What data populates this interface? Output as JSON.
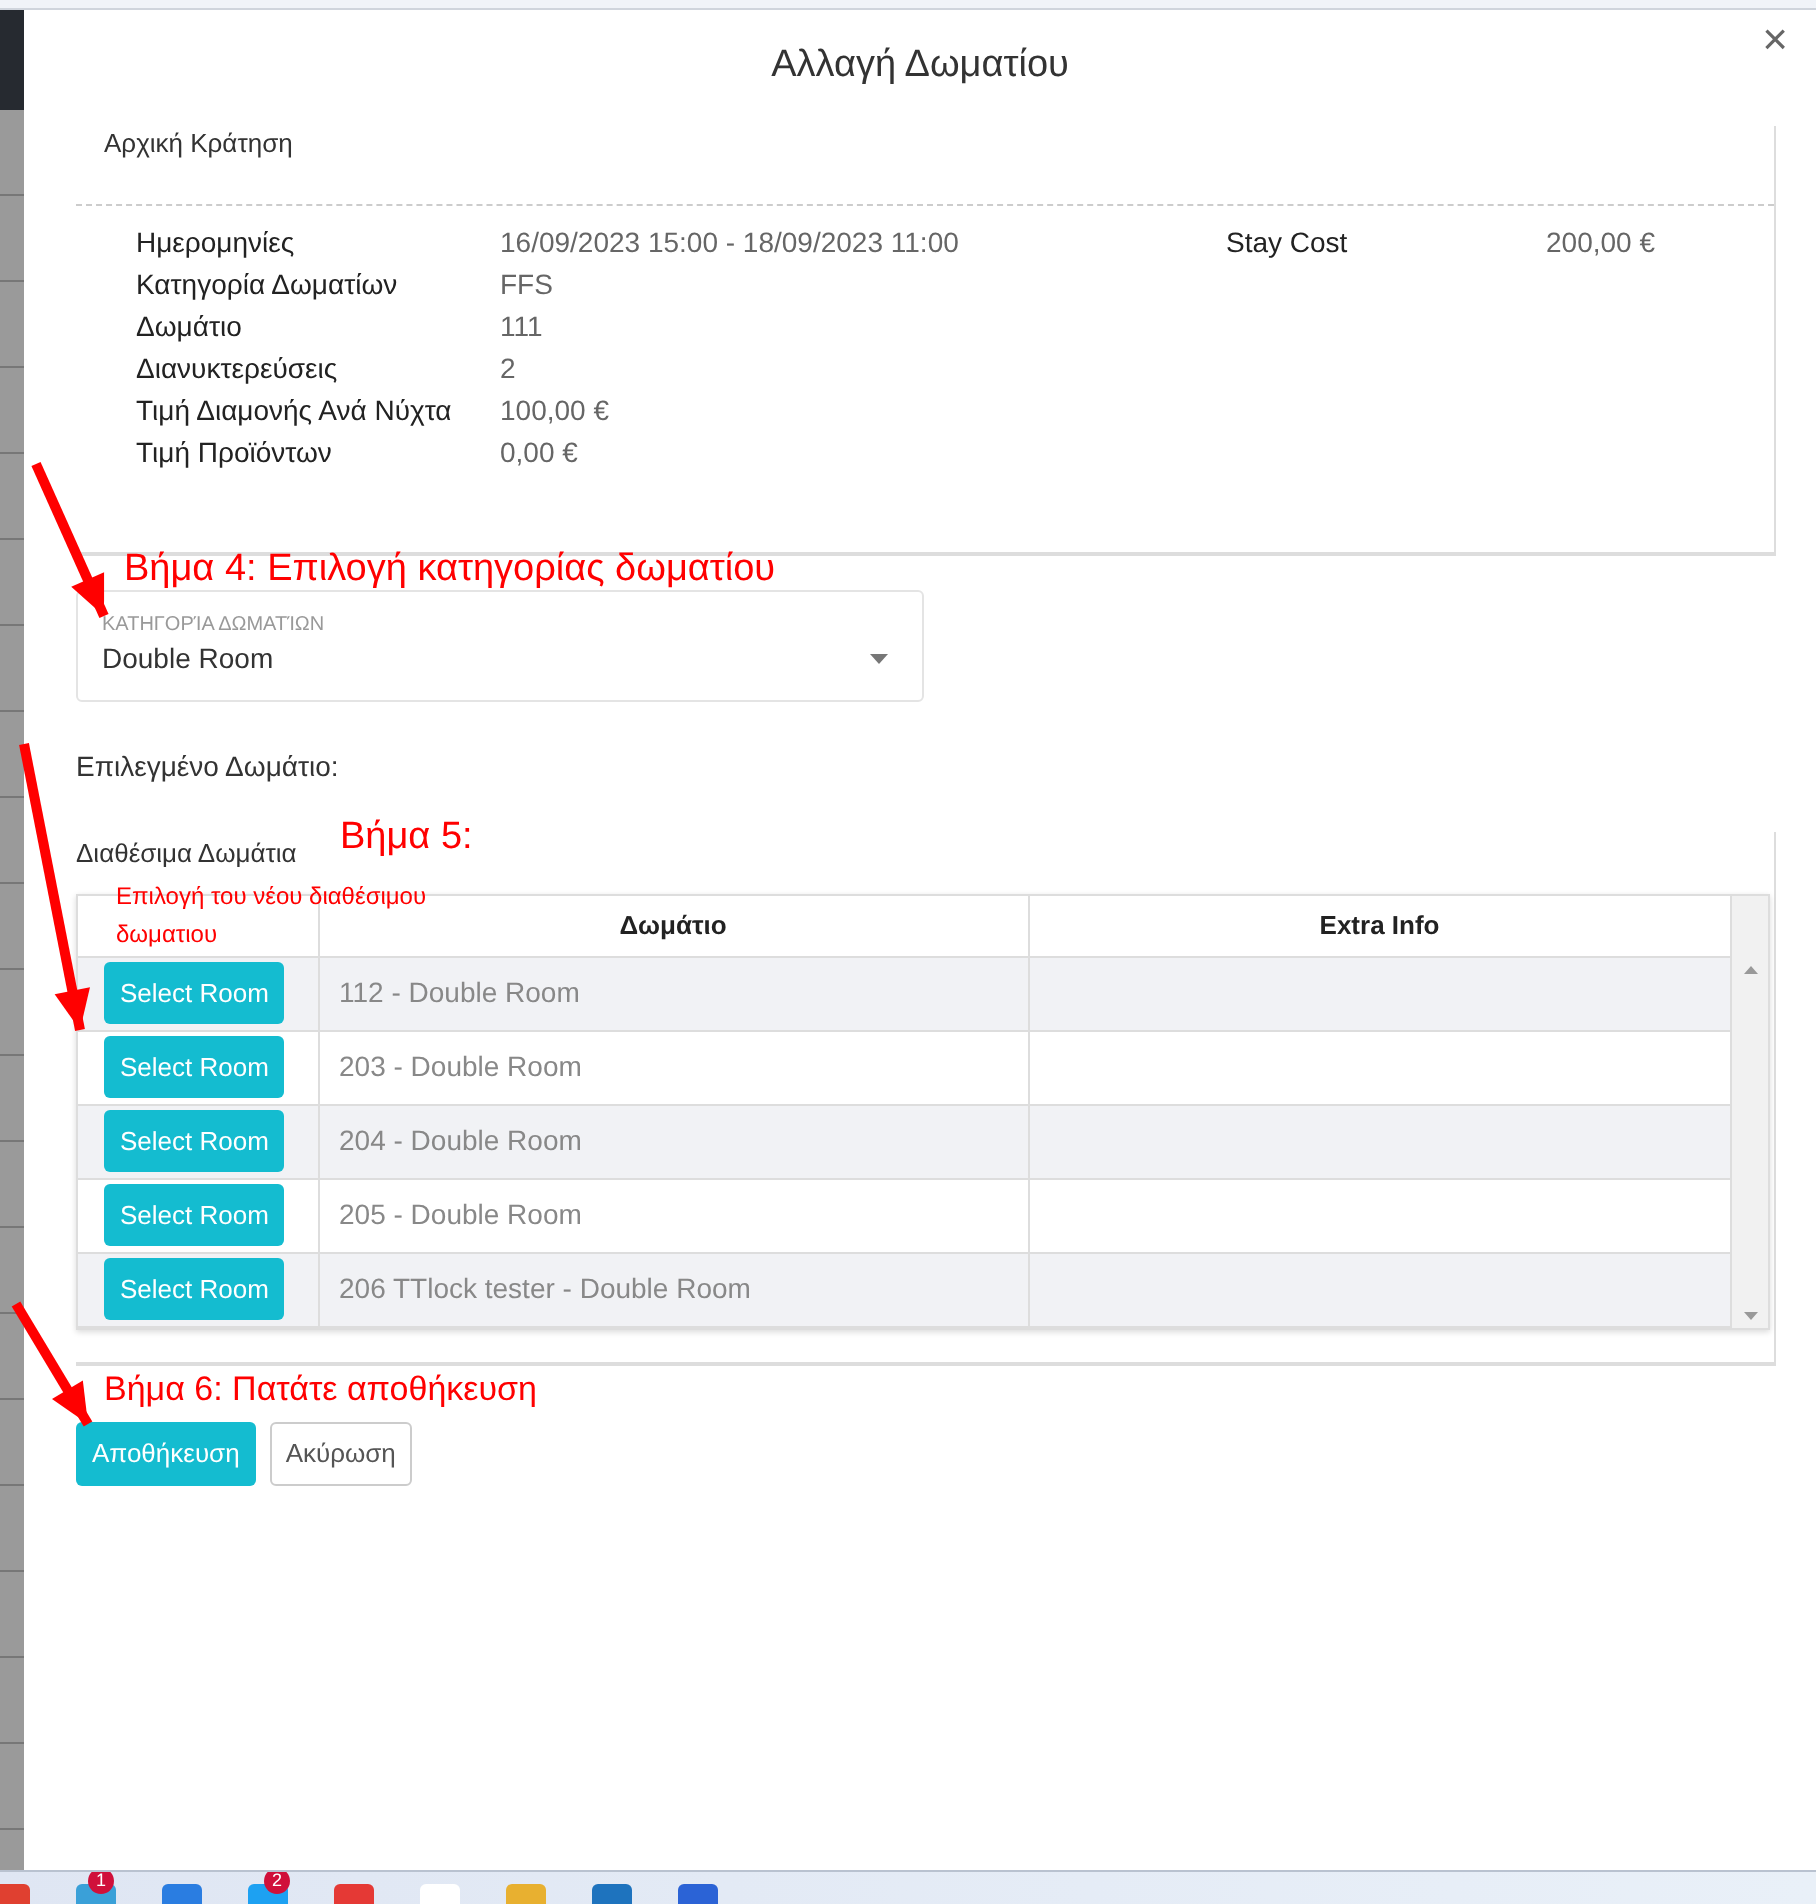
{
  "modal": {
    "title": "Αλλαγή Δωματίου",
    "close": "×"
  },
  "original_booking": {
    "title": "Αρχική Κράτηση",
    "fields": [
      {
        "label": "Ημερομηνίες",
        "value": "16/09/2023 15:00 - 18/09/2023 11:00"
      },
      {
        "label": "Κατηγορία Δωματίων",
        "value": "FFS"
      },
      {
        "label": "Δωμάτιο",
        "value": "111"
      },
      {
        "label": "Διανυκτερεύσεις",
        "value": "2"
      },
      {
        "label": "Τιμή Διαμονής Ανά Νύχτα",
        "value": "100,00 €"
      },
      {
        "label": "Τιμή Προϊόντων",
        "value": "0,00 €"
      }
    ],
    "stay_cost": {
      "label": "Stay Cost",
      "value": "200,00 €"
    }
  },
  "room_category": {
    "label": "ΚΑΤΗΓΟΡΊΑ ΔΩΜΑΤΊΩΝ",
    "value": "Double Room"
  },
  "selected_room": {
    "label": "Επιλεγμένο Δωμάτιο:"
  },
  "available_rooms": {
    "title": "Διαθέσιμα Δωμάτια",
    "columns": [
      "Δωμάτιο",
      "Extra Info"
    ],
    "rows": [
      {
        "action": "Select Room",
        "room": "112 - Double Room"
      },
      {
        "action": "Select Room",
        "room": "203 - Double Room"
      },
      {
        "action": "Select Room",
        "room": "204 - Double Room"
      },
      {
        "action": "Select Room",
        "room": "205 - Double Room"
      },
      {
        "action": "Select Room",
        "room": "206 TTlock tester - Double Room"
      }
    ]
  },
  "buttons": [
    {
      "label": "Αποθήκευση",
      "kind": "primary"
    },
    {
      "label": "Ακύρωση",
      "kind": "secondary"
    }
  ],
  "annotations": [
    "Βήμα 4: Επιλογή κατηγορίας δωματίου",
    "Βήμα 5:",
    "Επιλογή του νέου διαθέσιμου δωματιου",
    "Βήμα 6: Πατάτε αποθήκευση"
  ],
  "taskbar": {
    "badges": [
      "1",
      "2"
    ]
  }
}
